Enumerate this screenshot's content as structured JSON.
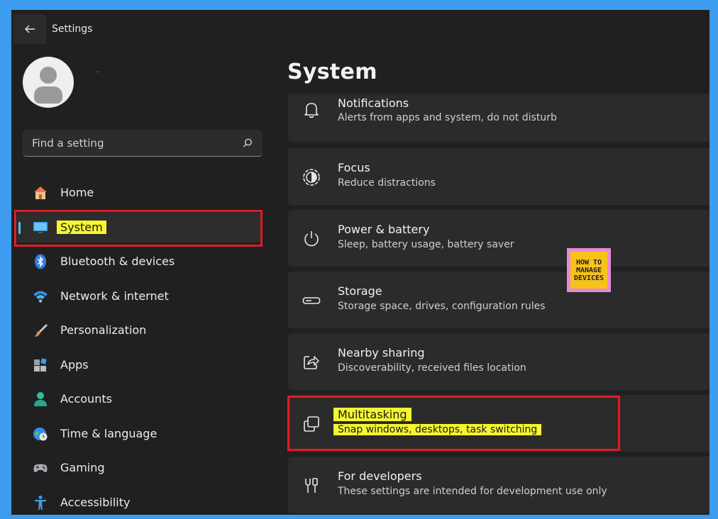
{
  "window": {
    "title": "Settings"
  },
  "user": {
    "name": "."
  },
  "search": {
    "placeholder": "Find a setting"
  },
  "sidebar": {
    "items": [
      {
        "label": "Home",
        "icon": "home-icon"
      },
      {
        "label": "System",
        "icon": "monitor-icon",
        "selected": true
      },
      {
        "label": "Bluetooth & devices",
        "icon": "bluetooth-icon"
      },
      {
        "label": "Network & internet",
        "icon": "wifi-icon"
      },
      {
        "label": "Personalization",
        "icon": "brush-icon"
      },
      {
        "label": "Apps",
        "icon": "apps-icon"
      },
      {
        "label": "Accounts",
        "icon": "person-icon"
      },
      {
        "label": "Time & language",
        "icon": "globe-clock-icon"
      },
      {
        "label": "Gaming",
        "icon": "gamepad-icon"
      },
      {
        "label": "Accessibility",
        "icon": "accessibility-icon"
      }
    ]
  },
  "main": {
    "title": "System",
    "cards": [
      {
        "title": "Notifications",
        "subtitle": "Alerts from apps and system, do not disturb",
        "icon": "bell-icon"
      },
      {
        "title": "Focus",
        "subtitle": "Reduce distractions",
        "icon": "focus-icon"
      },
      {
        "title": "Power & battery",
        "subtitle": "Sleep, battery usage, battery saver",
        "icon": "power-icon"
      },
      {
        "title": "Storage",
        "subtitle": "Storage space, drives, configuration rules",
        "icon": "storage-icon"
      },
      {
        "title": "Nearby sharing",
        "subtitle": "Discoverability, received files location",
        "icon": "share-icon"
      },
      {
        "title": "Multitasking",
        "subtitle": "Snap windows, desktops, task switching",
        "icon": "multitasking-icon",
        "highlighted": true
      },
      {
        "title": "For developers",
        "subtitle": "These settings are intended for development use only",
        "icon": "developer-tools-icon"
      }
    ]
  },
  "watermark": {
    "line1": "HOW TO",
    "line2": "MANAGE",
    "line3": "DEVICES"
  },
  "colors": {
    "accent": "#4cc2ff",
    "highlight": "#f5f530",
    "annotation_red": "#e01b24",
    "background": "#202020"
  }
}
